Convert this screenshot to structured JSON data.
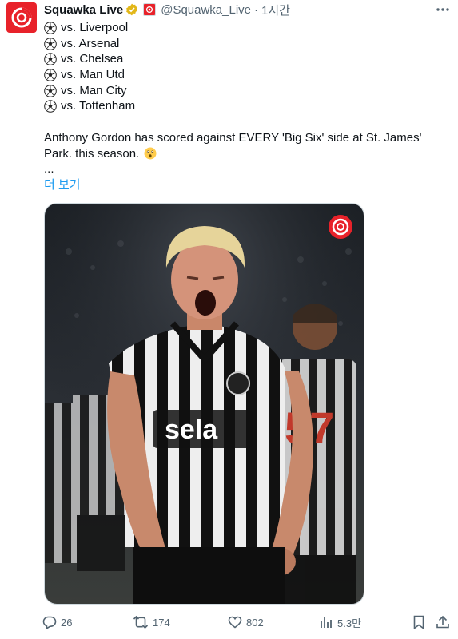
{
  "author": {
    "name": "Squawka Live",
    "handle": "@Squawka_Live",
    "separator": "·",
    "time": "1시간",
    "avatar_icon": "squawka-logo-icon",
    "verified_icon": "gold-verified-badge-icon",
    "affiliate_icon": "squawka-affiliate-badge-icon"
  },
  "tweet": {
    "lines": [
      "vs. Liverpool",
      "vs. Arsenal",
      "vs. Chelsea",
      "vs. Man Utd",
      "vs. Man City",
      "vs. Tottenham"
    ],
    "line_icon": "soccer-ball-icon",
    "paragraph": "Anthony Gordon has scored against EVERY 'Big Six' side at St. James' Park. this season.",
    "emoji_icon": "astonished-face-emoji",
    "ellipsis": "...",
    "show_more": "더 보기"
  },
  "media": {
    "watermark_icon": "squawka-logo-icon",
    "sponsor": "sela"
  },
  "actions": {
    "replies": "26",
    "retweets": "174",
    "likes": "802",
    "views": "5.3만"
  },
  "colors": {
    "accent": "#1d9bf0",
    "muted": "#536471",
    "brand_red": "#e8222a",
    "verified_gold": "#e2b719"
  }
}
